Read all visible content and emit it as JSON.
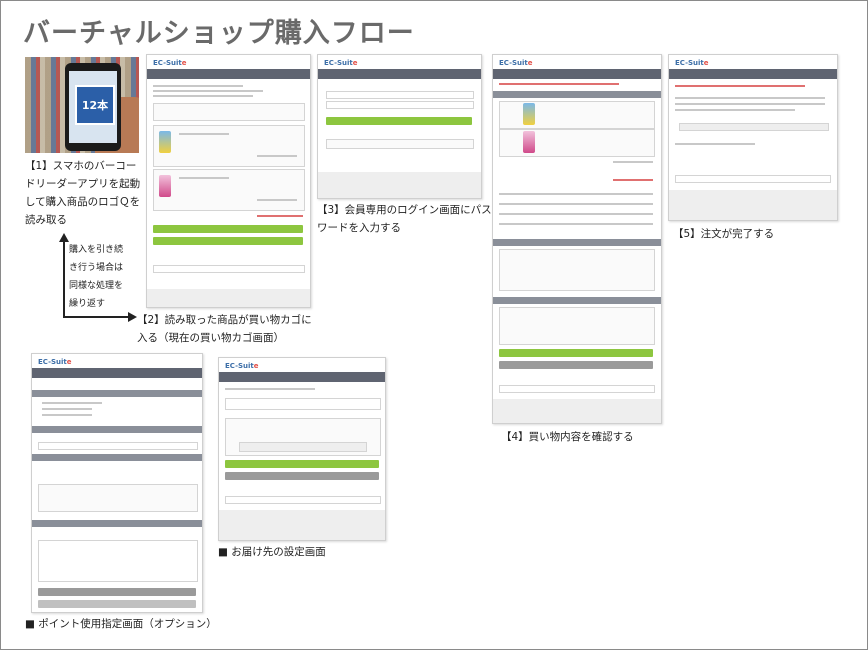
{
  "title": "バーチャルショップ購入フロー",
  "brand": {
    "logo_main": "EC-Suit",
    "logo_accent": "e"
  },
  "scan_badge": "12本",
  "steps": {
    "s1": {
      "line1": "【1】スマホのバーコー",
      "line2": "ドリーダーアプリを起動",
      "line3": "して購入商品のロゴＱを",
      "line4": "読み取る"
    },
    "loop": {
      "line1": "購入を引き続",
      "line2": "き行う場合は",
      "line3": "同様な処理を",
      "line4": "繰り返す"
    },
    "s2": {
      "line1": "【2】読み取った商品が買い物カゴに",
      "line2": "入る（現在の買い物カゴ画面）"
    },
    "s3": {
      "line1": "【3】会員専用のログイン画面にパス",
      "line2": "ワードを入力する"
    },
    "s4": "【4】買い物内容を確認する",
    "s5": "【5】注文が完了する",
    "points": "■ ポイント使用指定画面（オプション）",
    "delivery": "■ お届け先の設定画面"
  },
  "colors": {
    "header": "#5f6471",
    "green": "#8dc63f",
    "title": "#6a6a6a"
  }
}
